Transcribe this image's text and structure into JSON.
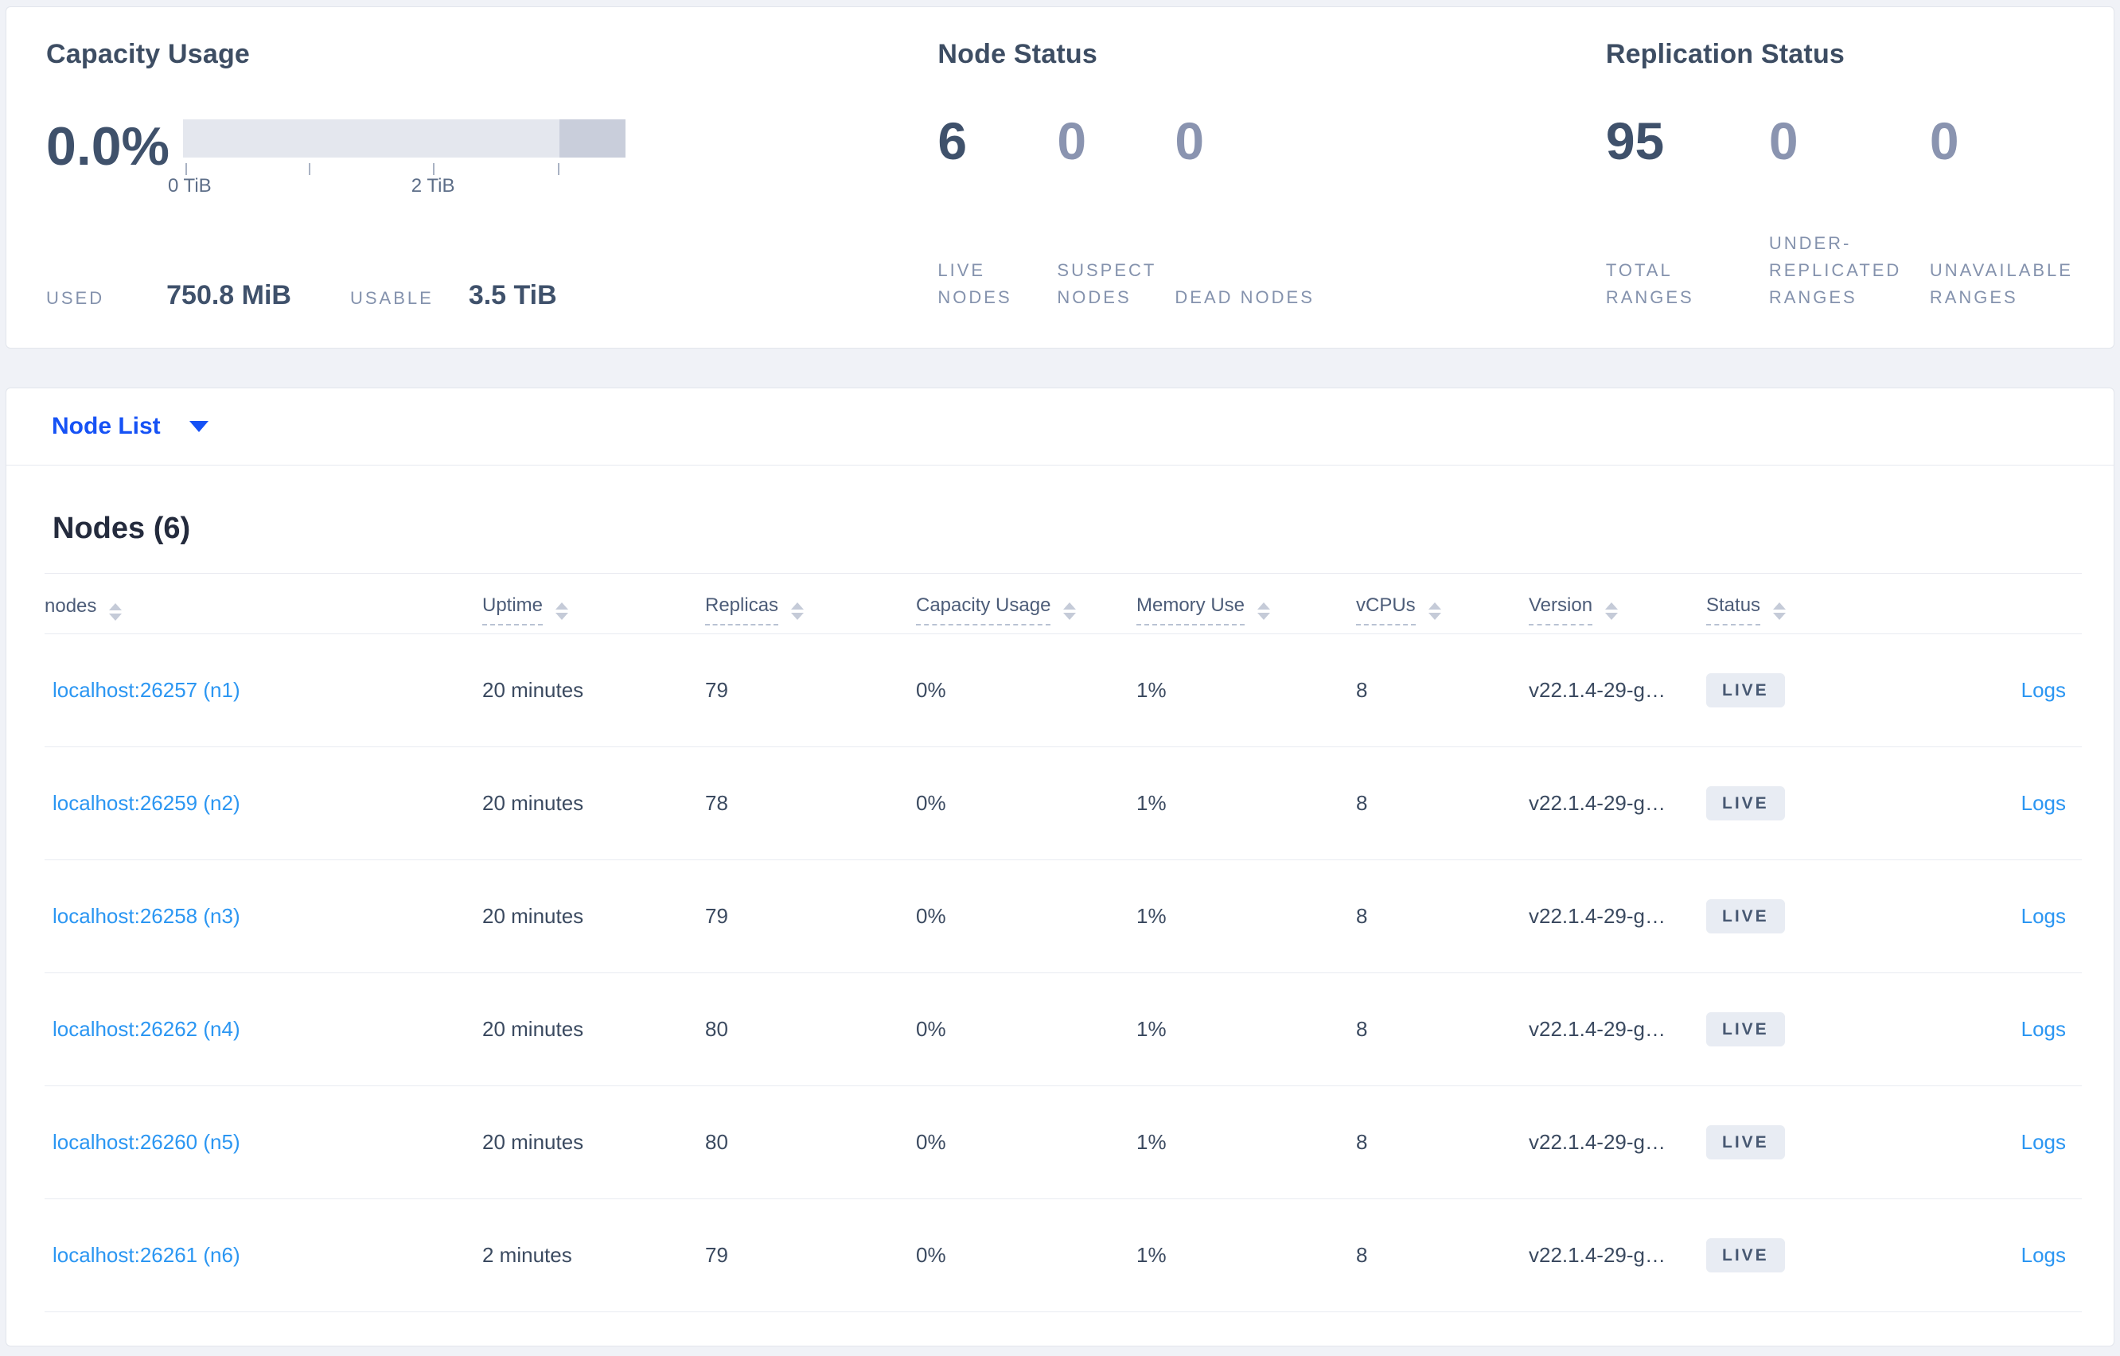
{
  "colors": {
    "page_background": "#f0f2f7",
    "card_background": "#ffffff",
    "card_border": "#e2e5ec",
    "title_text": "#3d4d63",
    "value_text": "#3f516b",
    "dim_value_text": "#8a94b0",
    "muted_label_text": "#8492ad",
    "table_text": "#3b4a60",
    "link_blue": "#2b96f2",
    "dropdown_blue": "#1652f5",
    "bar_light_gray": "#e4e7ee",
    "bar_dark_gray": "#c9cedb",
    "badge_background": "#e8ecf3",
    "badge_text": "#475872"
  },
  "capacity_panel": {
    "title": "Capacity Usage",
    "percent": "0.0%",
    "bar": {
      "light_fraction": 0.85,
      "dark_fraction": 0.15,
      "tick_positions_pct": [
        0.5,
        28.5,
        56.5,
        84.8
      ]
    },
    "axis_label_0": "0 TiB",
    "axis_label_2": "2 TiB",
    "used_label": "USED",
    "used_value": "750.8 MiB",
    "usable_label": "USABLE",
    "usable_value": "3.5 TiB"
  },
  "node_status_panel": {
    "title": "Node Status",
    "stats": [
      {
        "value": "6",
        "label": "LIVE NODES",
        "dim": false
      },
      {
        "value": "0",
        "label": "SUSPECT NODES",
        "dim": true
      },
      {
        "value": "0",
        "label": "DEAD NODES",
        "dim": true
      }
    ]
  },
  "replication_panel": {
    "title": "Replication Status",
    "stats": [
      {
        "value": "95",
        "label": "TOTAL RANGES",
        "dim": false
      },
      {
        "value": "0",
        "label": "UNDER-REPLICATED RANGES",
        "dim": true
      },
      {
        "value": "0",
        "label": "UNAVAILABLE RANGES",
        "dim": true
      }
    ]
  },
  "node_list": {
    "dropdown_label": "Node List",
    "caret_icon": "caret-down"
  },
  "table": {
    "heading": "Nodes (6)",
    "columns": [
      {
        "label": "nodes"
      },
      {
        "label": "Uptime"
      },
      {
        "label": "Replicas"
      },
      {
        "label": "Capacity Usage"
      },
      {
        "label": "Memory Use"
      },
      {
        "label": "vCPUs"
      },
      {
        "label": "Version"
      },
      {
        "label": "Status"
      },
      {
        "label": ""
      }
    ],
    "rows": [
      {
        "node": "localhost:26257 (n1)",
        "uptime": "20 minutes",
        "replicas": "79",
        "capacity": "0%",
        "memory": "1%",
        "vcpus": "8",
        "version": "v22.1.4-29-g…",
        "status": "LIVE",
        "logs": "Logs"
      },
      {
        "node": "localhost:26259 (n2)",
        "uptime": "20 minutes",
        "replicas": "78",
        "capacity": "0%",
        "memory": "1%",
        "vcpus": "8",
        "version": "v22.1.4-29-g…",
        "status": "LIVE",
        "logs": "Logs"
      },
      {
        "node": "localhost:26258 (n3)",
        "uptime": "20 minutes",
        "replicas": "79",
        "capacity": "0%",
        "memory": "1%",
        "vcpus": "8",
        "version": "v22.1.4-29-g…",
        "status": "LIVE",
        "logs": "Logs"
      },
      {
        "node": "localhost:26262 (n4)",
        "uptime": "20 minutes",
        "replicas": "80",
        "capacity": "0%",
        "memory": "1%",
        "vcpus": "8",
        "version": "v22.1.4-29-g…",
        "status": "LIVE",
        "logs": "Logs"
      },
      {
        "node": "localhost:26260 (n5)",
        "uptime": "20 minutes",
        "replicas": "80",
        "capacity": "0%",
        "memory": "1%",
        "vcpus": "8",
        "version": "v22.1.4-29-g…",
        "status": "LIVE",
        "logs": "Logs"
      },
      {
        "node": "localhost:26261 (n6)",
        "uptime": "2 minutes",
        "replicas": "79",
        "capacity": "0%",
        "memory": "1%",
        "vcpus": "8",
        "version": "v22.1.4-29-g…",
        "status": "LIVE",
        "logs": "Logs"
      }
    ]
  }
}
